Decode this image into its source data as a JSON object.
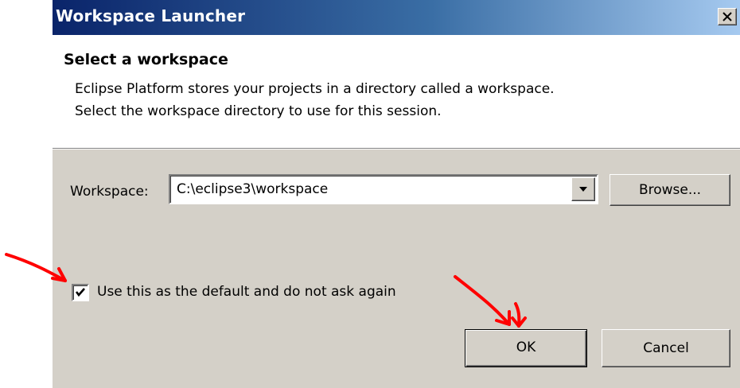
{
  "window": {
    "title": "Workspace Launcher"
  },
  "header": {
    "title": "Select a workspace",
    "line1": "Eclipse Platform stores your projects in a directory called a workspace.",
    "line2": "Select the workspace directory to use for this session."
  },
  "workspace": {
    "label": "Workspace:",
    "value": "C:\\eclipse3\\workspace",
    "browse_label": "Browse..."
  },
  "default_checkbox": {
    "label": "Use this as the default and do not ask again",
    "checked": true
  },
  "buttons": {
    "ok": "OK",
    "cancel": "Cancel"
  },
  "colors": {
    "titlebar_start": "#0a246a",
    "titlebar_end": "#a6caf0",
    "dialog_bg": "#d4d0c8",
    "annotation_arrow": "#ff0000"
  },
  "icons": {
    "close": "close-icon",
    "dropdown": "chevron-down-icon",
    "check": "check-icon",
    "annotation": "red-arrow-annotation"
  }
}
